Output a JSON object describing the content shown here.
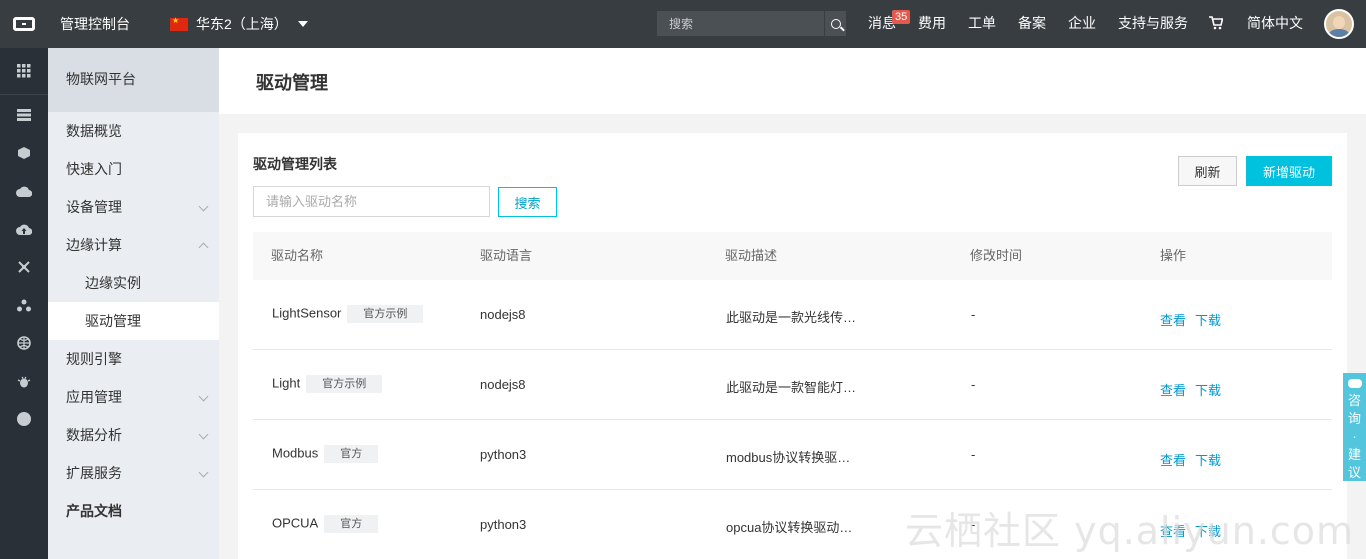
{
  "topbar": {
    "console_title": "管理控制台",
    "region": "华东2（上海）",
    "search_placeholder": "搜索",
    "nav": {
      "messages": "消息",
      "messages_badge": "35",
      "billing": "费用",
      "tickets": "工单",
      "icp": "备案",
      "enterprise": "企业",
      "support": "支持与服务",
      "language": "简体中文"
    }
  },
  "rail": {
    "icons": [
      "grid-icon",
      "database-icon",
      "cube-icon",
      "cloud-icon",
      "cloud-upload-icon",
      "network-icon",
      "cluster-icon",
      "globe-icon",
      "bug-icon",
      "circle-icon"
    ]
  },
  "sidebar": {
    "header": "物联网平台",
    "items": [
      {
        "label": "数据概览"
      },
      {
        "label": "快速入门"
      },
      {
        "label": "设备管理"
      },
      {
        "label": "边缘计算"
      },
      {
        "label": "边缘实例"
      },
      {
        "label": "驱动管理"
      },
      {
        "label": "规则引擎"
      },
      {
        "label": "应用管理"
      },
      {
        "label": "数据分析"
      },
      {
        "label": "扩展服务"
      },
      {
        "label": "产品文档"
      }
    ]
  },
  "page": {
    "title": "驱动管理",
    "list_title": "驱动管理列表",
    "filter_placeholder": "请输入驱动名称",
    "search_label": "搜索",
    "refresh_label": "刷新",
    "add_label": "新增驱动"
  },
  "table": {
    "columns": [
      "驱动名称",
      "驱动语言",
      "驱动描述",
      "修改时间",
      "操作"
    ],
    "rows": [
      {
        "name": "LightSensor",
        "tag": "官方示例",
        "language": "nodejs8",
        "description": "此驱动是一款光线传…",
        "modified": "-",
        "view": "查看",
        "download": "下载"
      },
      {
        "name": "Light",
        "tag": "官方示例",
        "language": "nodejs8",
        "description": "此驱动是一款智能灯…",
        "modified": "-",
        "view": "查看",
        "download": "下载"
      },
      {
        "name": "Modbus",
        "tag": "官方",
        "language": "python3",
        "description": "modbus协议转换驱…",
        "modified": "-",
        "view": "查看",
        "download": "下载"
      },
      {
        "name": "OPCUA",
        "tag": "官方",
        "language": "python3",
        "description": "opcua协议转换驱动…",
        "modified": "-",
        "view": "查看",
        "download": "下载"
      }
    ]
  },
  "float_widget": {
    "consult": "咨询",
    "dot": "·",
    "suggest": "建议"
  },
  "watermark": "云栖社区 yq.aliyun.com"
}
